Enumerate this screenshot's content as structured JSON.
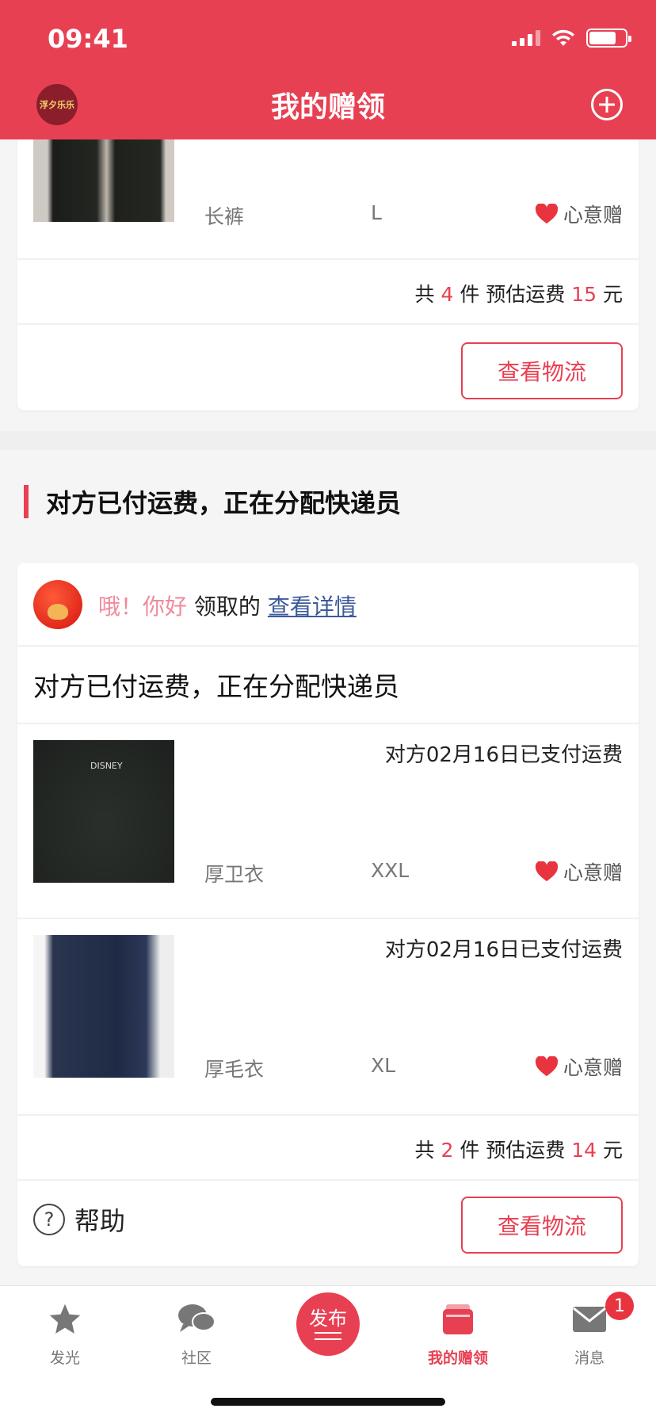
{
  "status_bar": {
    "time": "09:41"
  },
  "header": {
    "title": "我的赠领",
    "logo_text": "浮夕乐乐"
  },
  "card1": {
    "item": {
      "name": "长裤",
      "size": "L",
      "gift_label": "心意赠"
    },
    "total": {
      "prefix": "共",
      "count": "4",
      "unit": "件 预估运费",
      "fee": "15",
      "currency": "元"
    },
    "logistics_btn": "查看物流"
  },
  "section2": {
    "title": "对方已付运费，正在分配快递员",
    "greet": {
      "name": "哦！你好",
      "action": "领取的",
      "link": "查看详情"
    },
    "status_line": "对方已付运费，正在分配快递员",
    "items": [
      {
        "pay_text": "对方02月16日已支付运费",
        "name": "厚卫衣",
        "size": "XXL",
        "gift_label": "心意赠",
        "image_text": "DISNEY"
      },
      {
        "pay_text": "对方02月16日已支付运费",
        "name": "厚毛衣",
        "size": "XL",
        "gift_label": "心意赠"
      }
    ],
    "total": {
      "prefix": "共",
      "count": "2",
      "unit": "件 预估运费",
      "fee": "14",
      "currency": "元"
    },
    "help": "帮助",
    "logistics_btn": "查看物流"
  },
  "tabbar": {
    "tabs": [
      {
        "label": "发光",
        "icon": "star-icon"
      },
      {
        "label": "社区",
        "icon": "chat-icon"
      },
      {
        "label": "发布",
        "icon": "publish-icon"
      },
      {
        "label": "我的赠领",
        "icon": "wallet-icon",
        "active": true
      },
      {
        "label": "消息",
        "icon": "mail-icon"
      }
    ],
    "message_badge": "1"
  },
  "colors": {
    "brand": "#e84053",
    "link": "#3b5a9a",
    "pink": "#f08a9a"
  }
}
